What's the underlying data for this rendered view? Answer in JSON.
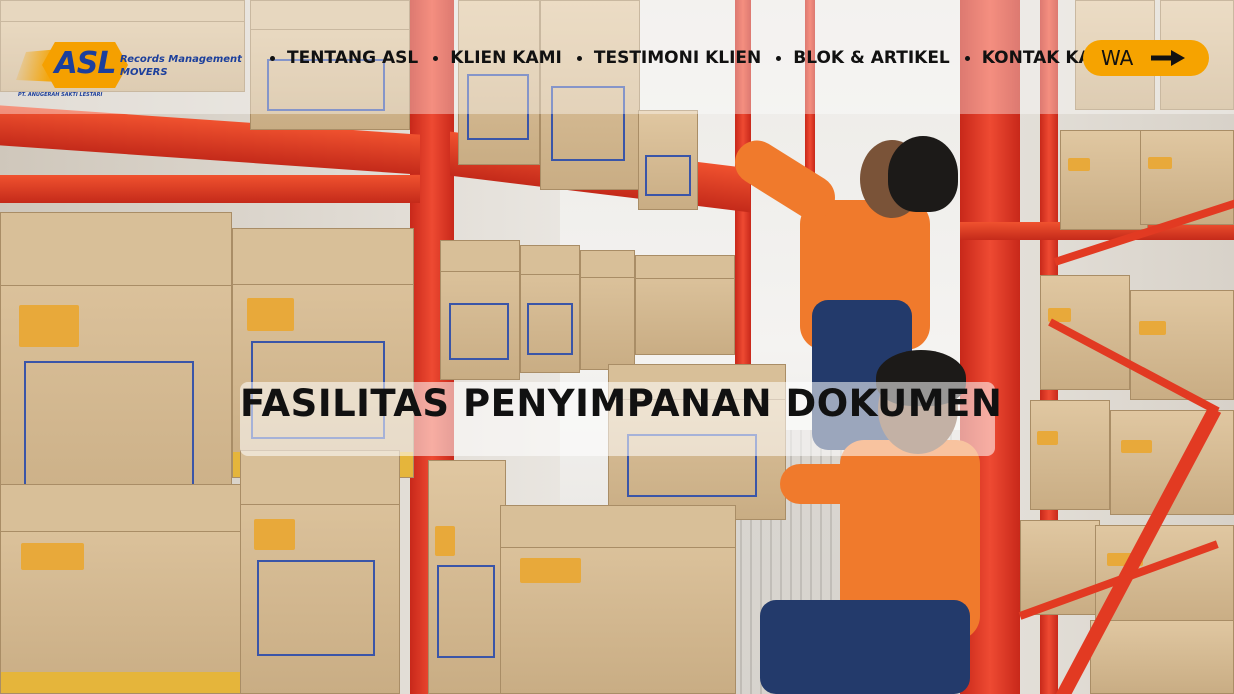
{
  "brand": {
    "logo_text": "ASL",
    "tagline_line1": "Records Management",
    "tagline_line2": "MOVERS",
    "company_name": "PT. ANUGERAH SAKTI LESTARI",
    "accent_color": "#f5a000",
    "brand_color": "#1c3f9c"
  },
  "nav": {
    "items": [
      {
        "label": "TENTANG ASL"
      },
      {
        "label": "KLIEN KAMI"
      },
      {
        "label": "TESTIMONI KLIEN"
      },
      {
        "label": "BLOK & ARTIKEL"
      },
      {
        "label": "KONTAK KAMI"
      }
    ]
  },
  "cta": {
    "label": "WA",
    "icon": "arrow-right-icon"
  },
  "hero": {
    "headline": "FASILITAS PENYIMPANAN DOKUMEN"
  }
}
